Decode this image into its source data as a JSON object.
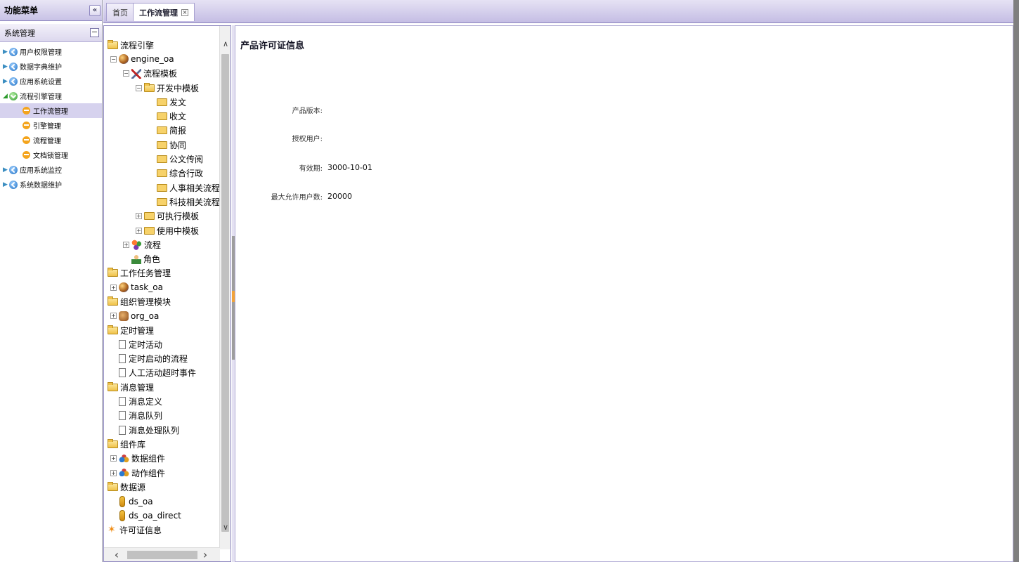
{
  "sidebar": {
    "header": "功能菜单",
    "collapse_icon": "«",
    "section": "系统管理",
    "section_toggle": "−",
    "items": [
      {
        "label": "用户权限管理"
      },
      {
        "label": "数据字典维护"
      },
      {
        "label": "应用系统设置"
      },
      {
        "label": "流程引擎管理"
      },
      {
        "label": "应用系统监控"
      },
      {
        "label": "系统数据维护"
      }
    ],
    "subitems": [
      {
        "label": "工作流管理"
      },
      {
        "label": "引擎管理"
      },
      {
        "label": "流程管理"
      },
      {
        "label": "文档锁管理"
      }
    ]
  },
  "tabs": {
    "home": "首页",
    "active": "工作流管理",
    "close": "×"
  },
  "tree": {
    "nodes": [
      "流程引擎",
      "engine_oa",
      "流程模板",
      "开发中模板",
      "发文",
      "收文",
      "简报",
      "协同",
      "公文传阅",
      "综合行政",
      "人事相关流程",
      "科技相关流程",
      "可执行模板",
      "使用中模板",
      "流程",
      "角色",
      "工作任务管理",
      "task_oa",
      "组织管理模块",
      "org_oa",
      "定时管理",
      "定时活动",
      "定时启动的流程",
      "人工活动超时事件",
      "消息管理",
      "消息定义",
      "消息队列",
      "消息处理队列",
      "组件库",
      "数据组件",
      "动作组件",
      "数据源",
      "ds_oa",
      "ds_oa_direct",
      "许可证信息"
    ]
  },
  "scroll": {
    "up": "∧",
    "down": "∨",
    "left": "‹",
    "right": "›"
  },
  "content": {
    "title": "产品许可证信息",
    "fields": [
      {
        "label": "产品版本:",
        "value": ""
      },
      {
        "label": "授权用户:",
        "value": ""
      },
      {
        "label": "有效期:",
        "value": "3000-10-01"
      },
      {
        "label": "最大允许用户数:",
        "value": "20000"
      }
    ]
  }
}
